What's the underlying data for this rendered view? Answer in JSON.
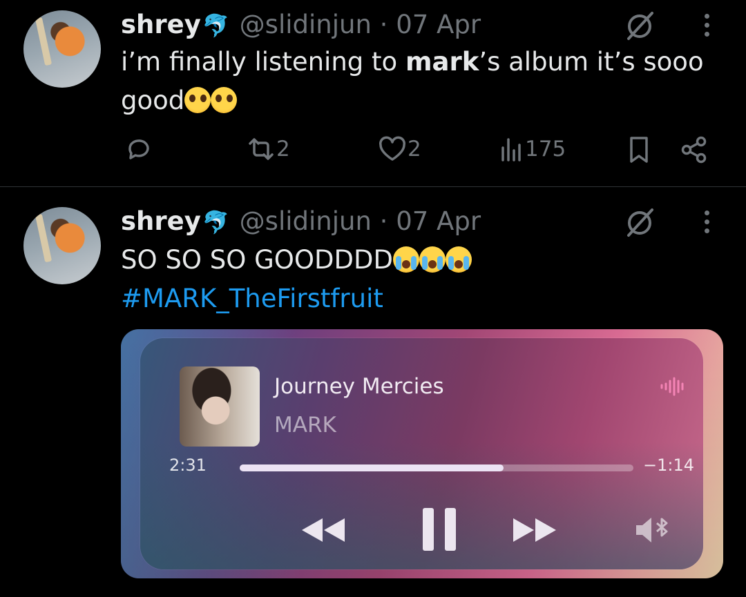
{
  "tweets": [
    {
      "name": "shrey",
      "badge_emoji": "🐬",
      "handle": "@slidinjun",
      "date_sep": "·",
      "date": "07 Apr",
      "text_parts": [
        "i’m finally listening to ",
        "mark",
        "’s album it’s sooo good"
      ],
      "emojis": [
        "pleading-face",
        "pleading-face"
      ],
      "stats": {
        "replies": "",
        "reposts": "2",
        "likes": "2",
        "views": "175"
      }
    },
    {
      "name": "shrey",
      "badge_emoji": "🐬",
      "handle": "@slidinjun",
      "date_sep": "·",
      "date": "07 Apr",
      "text": "SO SO SO GOODDDD",
      "emojis": [
        "loudly-crying-face",
        "loudly-crying-face",
        "loudly-crying-face"
      ],
      "hashtag": "#MARK_TheFirstfruit"
    }
  ],
  "player": {
    "song": "Journey Mercies",
    "artist": "MARK",
    "elapsed": "2:31",
    "remaining": "−1:14",
    "progress": 0.67
  },
  "colors": {
    "link": "#1d9bf0",
    "muted": "#71767b",
    "text": "#e7e9ea",
    "background": "#000000"
  }
}
